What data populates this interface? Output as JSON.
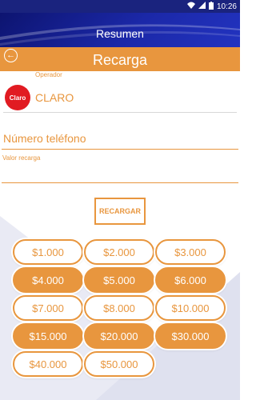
{
  "status_bar": {
    "time": "10:26"
  },
  "header": {
    "title": "Resumen"
  },
  "section": {
    "title": "Recarga",
    "back_icon": "←"
  },
  "operator": {
    "label": "Operador",
    "logo_text": "Claro",
    "name": "CLARO"
  },
  "phone": {
    "placeholder": "Número teléfono"
  },
  "valor": {
    "label": "Valor recarga",
    "value": ""
  },
  "recargar_label": "RECARGAR",
  "amounts": [
    "$1.000",
    "$2.000",
    "$3.000",
    "$4.000",
    "$5.000",
    "$6.000",
    "$7.000",
    "$8.000",
    "$10.000",
    "$15.000",
    "$20.000",
    "$30.000",
    "$40.000",
    "$50.000"
  ],
  "amounts_filled": [
    false,
    false,
    false,
    true,
    true,
    true,
    false,
    false,
    false,
    true,
    true,
    true,
    false,
    false
  ],
  "colors": {
    "accent": "#e8963e",
    "header": "#1b28a8",
    "claro_red": "#e11b22"
  }
}
